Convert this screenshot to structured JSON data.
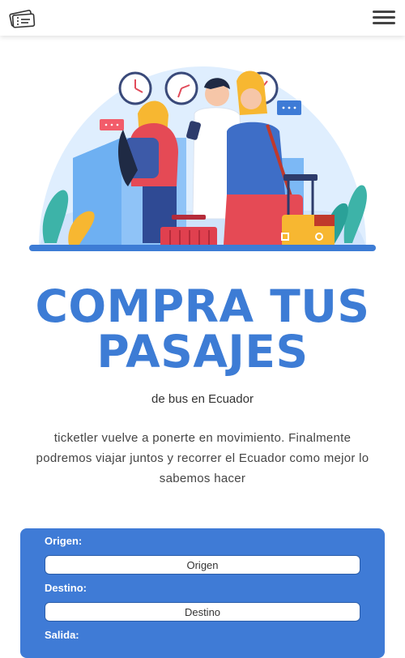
{
  "header": {
    "logo_icon": "ticket-icon",
    "menu_icon": "hamburger-menu-icon"
  },
  "hero": {
    "illustration": "travelers-illustration"
  },
  "title": {
    "line1": "COMPRA TUS",
    "line2": "PASAJES"
  },
  "subtitle": "de bus en Ecuador",
  "description": "ticketler vuelve a ponerte en movimiento. Finalmente podremos viajar juntos y recorrer el Ecuador como mejor lo sabemos hacer",
  "form": {
    "origin_label": "Origen:",
    "origin_placeholder": "Origen",
    "destination_label": "Destino:",
    "destination_placeholder": "Destino",
    "departure_label": "Salida:"
  },
  "colors": {
    "primary": "#3d7cd5",
    "card": "#3f7bd6"
  }
}
